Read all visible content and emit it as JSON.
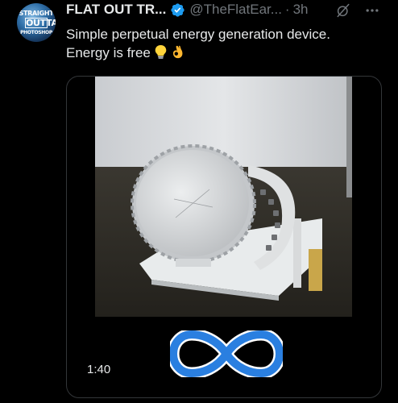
{
  "tweet": {
    "avatar_text": [
      "STRAIGHT",
      "OUTTA",
      "PHOTOSHOP"
    ],
    "display_name": "FLAT OUT TR...",
    "handle": "@TheFlatEar...",
    "separator": "·",
    "time": "3h",
    "text_line1": "Simple perpetual energy generation device.",
    "text_line2": "Energy is free",
    "emojis": [
      "light-bulb",
      "ok-hand"
    ]
  },
  "media": {
    "duration": "1:40",
    "overlay_icon": "infinity-icon"
  },
  "colors": {
    "background": "#000000",
    "text": "#e7e9ea",
    "muted": "#71767b",
    "verified": "#1d9bf0",
    "infinity_blue": "#2a7fe0"
  }
}
